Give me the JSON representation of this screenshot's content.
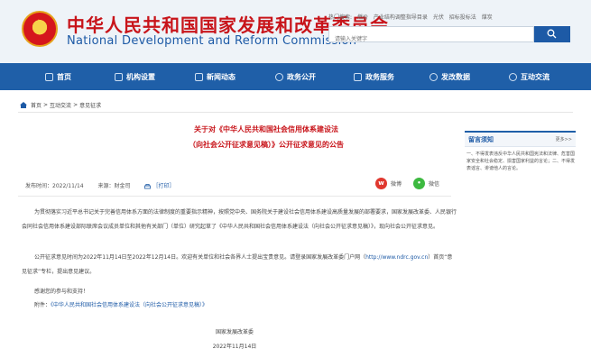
{
  "header": {
    "cn_title": "中华人民共和国国家发展和改革委员会",
    "en_title": "National Development and Reform Commission",
    "hot_search": [
      "热门搜索:",
      "燃价",
      "产业结构调整指导目录",
      "光伏",
      "招标投标法",
      "煤炭"
    ],
    "search_placeholder": "请输入关键字"
  },
  "nav": {
    "items": [
      {
        "label": "首页",
        "icon": "home-icon"
      },
      {
        "label": "机构设置",
        "icon": "building-icon"
      },
      {
        "label": "新闻动态",
        "icon": "news-icon"
      },
      {
        "label": "政务公开",
        "icon": "open-government-icon"
      },
      {
        "label": "政务服务",
        "icon": "service-icon"
      },
      {
        "label": "发改数据",
        "icon": "data-icon"
      },
      {
        "label": "互动交流",
        "icon": "interaction-icon"
      }
    ]
  },
  "breadcrumb": {
    "home": "首页",
    "level2": "互动交流",
    "level3": "意见征求",
    "sep": ">"
  },
  "article": {
    "title_line1": "关于对《中华人民共和国社会信用体系建设法",
    "title_line2": "（向社会公开征求意见稿）》公开征求意见的公告",
    "publish_time": "发布时间：2022/11/14",
    "source": "来源：财金司",
    "print": "［打印］",
    "share_weibo": "微博",
    "share_wechat": "微信",
    "para1": "为贯彻落实习近平总书记关于完善信用体系方面的法律制度的重要指示精神，按照党中央、国务院关于建设社会信用体系建设高质量发展的部署要求，国家发展改革委、人民银行会同社会信用体系建设部际联席会议成员单位和其他有关部门（单位）研究起草了《中华人民共和国社会信用体系建设法（向社会公开征求意见稿）》，现向社会公开征求意见。",
    "para2_before": "公开征求意见时间为2022年11月14日至2022年12月14日。欢迎有关单位和社会各界人士提出宝贵意见。请登录国家发展改革委门户网（",
    "para2_link": "http://www.ndrc.gov.cn",
    "para2_after": "）首页“意见征求”专栏，提出意见建议。",
    "thanks": "感谢您的参与和支持！",
    "attachment_label": "附件：",
    "attachment_link": "《中华人民共和国社会信用体系建设法（向社会公开征求意见稿）》",
    "sign_org": "国家发展改革委",
    "sign_date": "2022年11月14日"
  },
  "sidebar": {
    "title": "留言须知",
    "more": "更多>>",
    "text": "一、不得发表违反中华人民共和国宪法和法律、危害国家安全和社会稳定、损害国家利益的言论；二、不得发表谣言、诽谤他人的言论。"
  },
  "colors": {
    "brand_blue": "#1f5fa8",
    "title_red": "#c8141a",
    "link_blue": "#1d5aa6"
  }
}
